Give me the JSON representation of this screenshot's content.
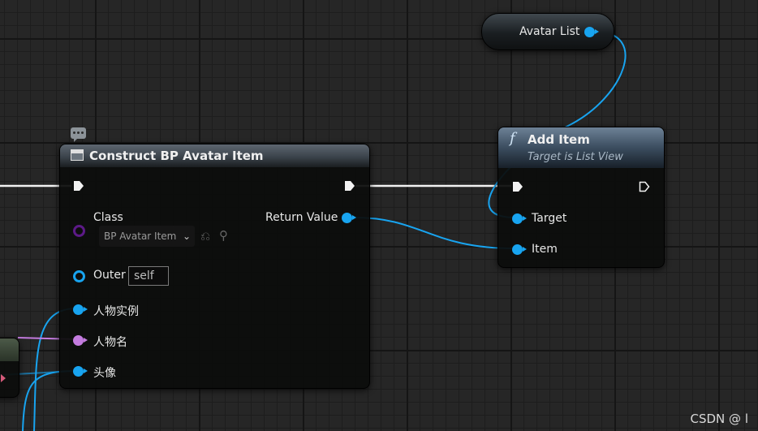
{
  "variable_node": {
    "label": "Avatar List"
  },
  "construct_node": {
    "title": "Construct BP Avatar Item",
    "inputs": {
      "class_label": "Class",
      "class_value": "BP Avatar Item",
      "outer_label": "Outer",
      "outer_value": "self",
      "character_instance_label": "人物实例",
      "character_name_label": "人物名",
      "avatar_label": "头像"
    },
    "outputs": {
      "return_value_label": "Return Value"
    },
    "comment_icon": "comment-bubble-icon"
  },
  "add_item_node": {
    "function_icon": "f",
    "title": "Add Item",
    "subtitle": "Target is List View",
    "inputs": {
      "target_label": "Target",
      "item_label": "Item"
    }
  },
  "colors": {
    "object_pin": "#18a4f0",
    "string_pin": "#c47cdf",
    "class_pin": "#5c1a87",
    "exec_wire": "#ffffff"
  },
  "watermark": "CSDN @ l"
}
